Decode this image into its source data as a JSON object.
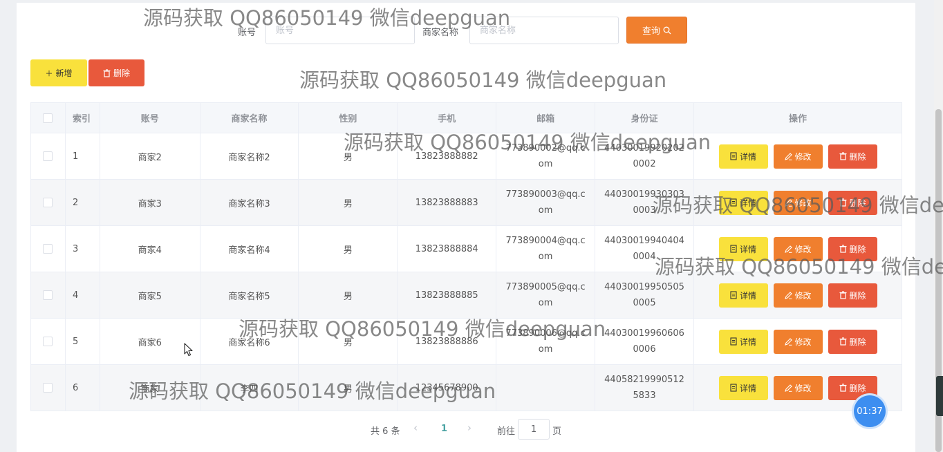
{
  "search": {
    "account_label": "账号",
    "account_placeholder": "账号",
    "merchant_label": "商家名称",
    "merchant_placeholder": "商家名称",
    "query_label": "查询"
  },
  "toolbar": {
    "add_label": "新增",
    "delete_label": "删除"
  },
  "table": {
    "headers": {
      "index": "索引",
      "account": "账号",
      "merchant": "商家名称",
      "gender": "性别",
      "phone": "手机",
      "email": "邮箱",
      "id_card": "身份证",
      "actions": "操作"
    },
    "action_labels": {
      "detail": "详情",
      "edit": "修改",
      "delete": "删除"
    },
    "rows": [
      {
        "index": "1",
        "account": "商家2",
        "merchant": "商家名称2",
        "gender": "男",
        "phone": "13823888882",
        "email": "773890002@qq.com",
        "id_card": "440300199202020002"
      },
      {
        "index": "2",
        "account": "商家3",
        "merchant": "商家名称3",
        "gender": "男",
        "phone": "13823888883",
        "email": "773890003@qq.com",
        "id_card": "440300199303030003"
      },
      {
        "index": "3",
        "account": "商家4",
        "merchant": "商家名称4",
        "gender": "男",
        "phone": "13823888884",
        "email": "773890004@qq.com",
        "id_card": "440300199404040004"
      },
      {
        "index": "4",
        "account": "商家5",
        "merchant": "商家名称5",
        "gender": "男",
        "phone": "13823888885",
        "email": "773890005@qq.com",
        "id_card": "440300199505050005"
      },
      {
        "index": "5",
        "account": "商家6",
        "merchant": "商家名称6",
        "gender": "男",
        "phone": "13823888886",
        "email": "773890006@qq.com",
        "id_card": "440300199606060006"
      },
      {
        "index": "6",
        "account": "商家",
        "merchant": "李四",
        "gender": "男",
        "phone": "12345678900",
        "email": "",
        "id_card": "440582199905125833"
      }
    ]
  },
  "pagination": {
    "total": "共 6 条",
    "current_page": "1",
    "goto_prefix": "前往",
    "goto_value": "1",
    "goto_suffix": "页"
  },
  "timer": "01:37",
  "watermark": "源码获取 QQ86050149 微信deepguan",
  "colors": {
    "primary_orange": "#f07f2e",
    "yellow": "#f9e13c",
    "red": "#e8593c",
    "timer_blue": "#3d8ef0"
  }
}
